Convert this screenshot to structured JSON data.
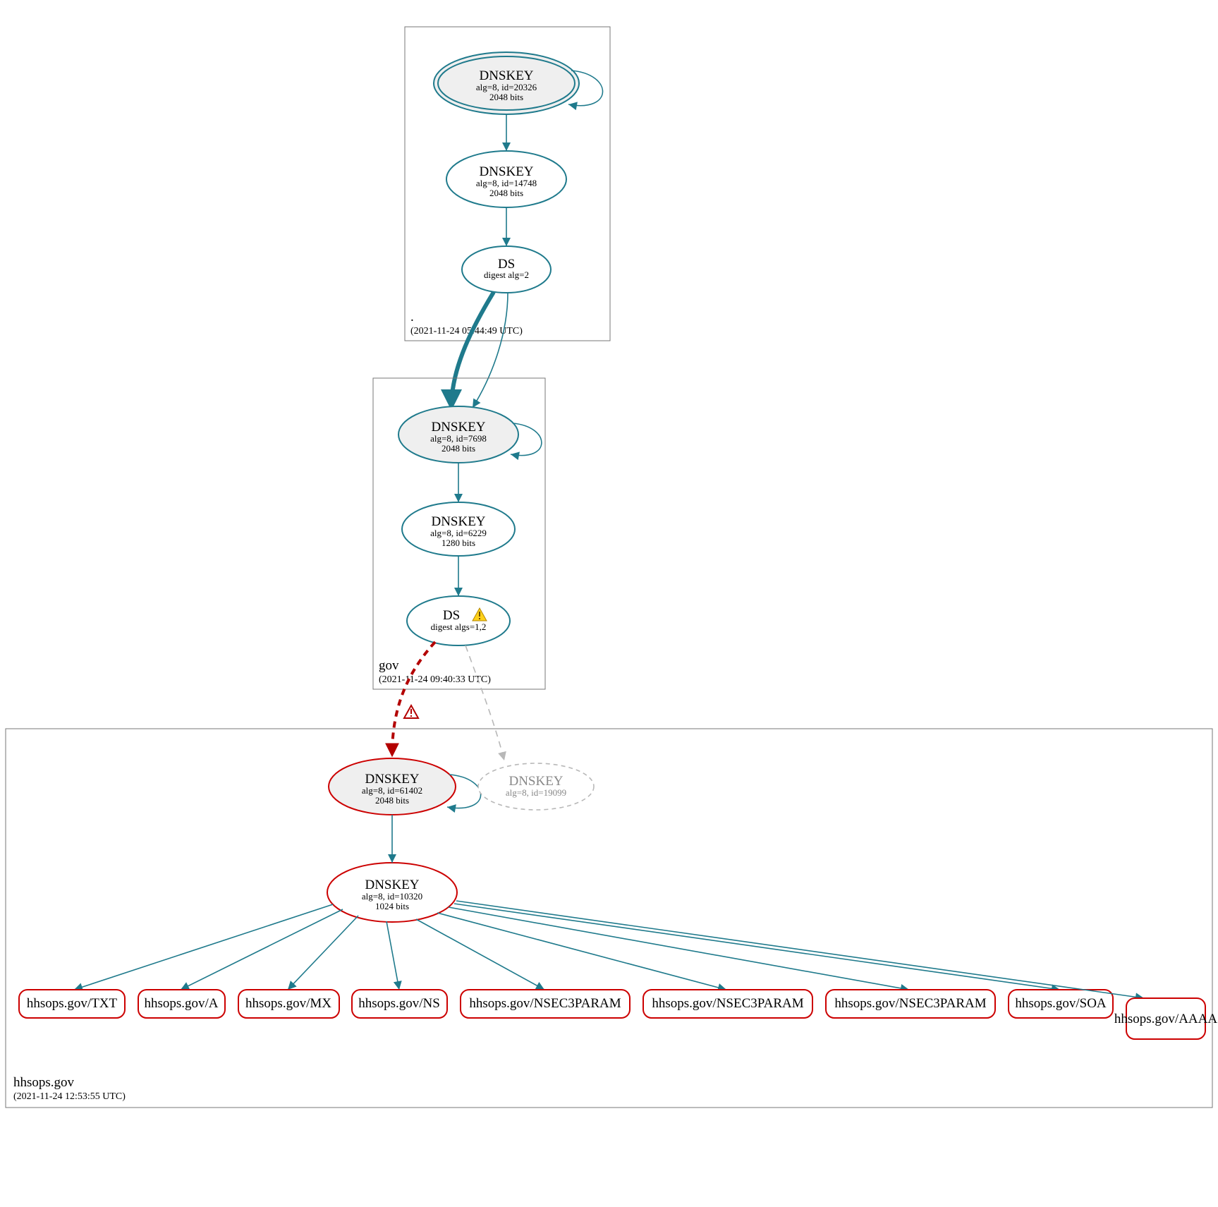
{
  "zones": {
    "root": {
      "label": ".",
      "timestamp": "(2021-11-24 05:44:49 UTC)",
      "nodes": {
        "ksk": {
          "title": "DNSKEY",
          "l1": "alg=8, id=20326",
          "l2": "2048 bits"
        },
        "zsk": {
          "title": "DNSKEY",
          "l1": "alg=8, id=14748",
          "l2": "2048 bits"
        },
        "ds": {
          "title": "DS",
          "l1": "digest alg=2"
        }
      }
    },
    "gov": {
      "label": "gov",
      "timestamp": "(2021-11-24 09:40:33 UTC)",
      "nodes": {
        "ksk": {
          "title": "DNSKEY",
          "l1": "alg=8, id=7698",
          "l2": "2048 bits"
        },
        "zsk": {
          "title": "DNSKEY",
          "l1": "alg=8, id=6229",
          "l2": "1280 bits"
        },
        "ds": {
          "title": "DS",
          "l1": "digest algs=1,2"
        }
      }
    },
    "hhsops": {
      "label": "hhsops.gov",
      "timestamp": "(2021-11-24 12:53:55 UTC)",
      "nodes": {
        "ksk": {
          "title": "DNSKEY",
          "l1": "alg=8, id=61402",
          "l2": "2048 bits"
        },
        "ghost": {
          "title": "DNSKEY",
          "l1": "alg=8, id=19099"
        },
        "zsk": {
          "title": "DNSKEY",
          "l1": "alg=8, id=10320",
          "l2": "1024 bits"
        }
      },
      "rrsets": [
        "hhsops.gov/TXT",
        "hhsops.gov/A",
        "hhsops.gov/MX",
        "hhsops.gov/NS",
        "hhsops.gov/NSEC3PARAM",
        "hhsops.gov/NSEC3PARAM",
        "hhsops.gov/NSEC3PARAM",
        "hhsops.gov/SOA",
        "hhsops.gov/AAAA"
      ]
    }
  }
}
